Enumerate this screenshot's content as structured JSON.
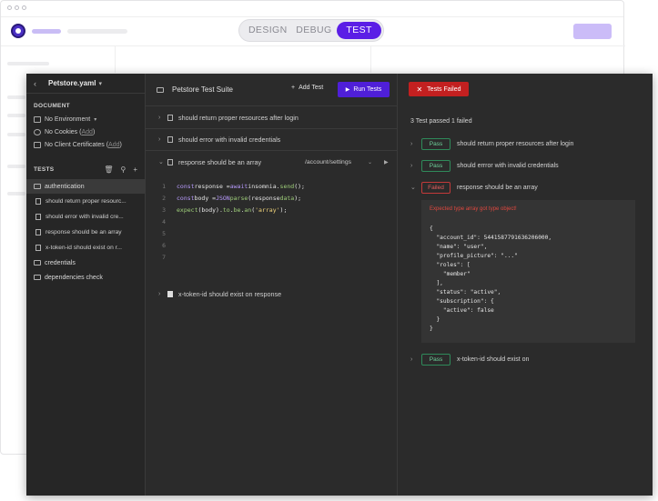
{
  "mode_switch": {
    "design": "DESIGN",
    "debug": "DEBUG",
    "test": "TEST"
  },
  "sidebar": {
    "file_name": "Petstore.yaml",
    "document_label": "DOCUMENT",
    "environment": "No Environment",
    "cookies_text": "No Cookies (",
    "cookies_link": "Add",
    "cookies_end": ")",
    "certs_text": "No Client Certificates (",
    "certs_link": "Add",
    "certs_end": ")",
    "tests_label": "TESTS",
    "groups": [
      {
        "label": "authentication"
      },
      {
        "label": "credentials"
      },
      {
        "label": "dependencies check"
      }
    ],
    "auth_items": [
      "should return proper resourc...",
      "should error with invalid cre...",
      "response should be an array",
      "x-token-id should exist on r..."
    ]
  },
  "suite": {
    "title": "Petstore Test Suite",
    "add_test": "Add Test",
    "run_tests": "Run Tests",
    "tests": [
      "should return proper resources after login",
      "should error with invalid credentials",
      "response should be an array",
      "x-token-id should exist on response"
    ],
    "request_path": "/account/settings",
    "line_numbers": [
      "1",
      "2",
      "3",
      "4",
      "5",
      "6",
      "7"
    ],
    "code": {
      "l1_kw": "const",
      "l1_a": " response = ",
      "l1_kw2": "await",
      "l1_b": " insomnia.",
      "l1_fn": "send",
      "l1_c": "();",
      "l2_kw": "const",
      "l2_a": " body = ",
      "l2_b": "JSON",
      "l2_c": " ",
      "l2_fn": "parse",
      "l2_d": "(response ",
      "l2_fn2": "data",
      "l2_e": ");",
      "l3_fn": "expect",
      "l3_a": "(body).",
      "l3_fn2": "to",
      "l3_b": ".",
      "l3_fn3": "be",
      "l3_c": ".",
      "l3_fn4": "an",
      "l3_d": "(",
      "l3_str": "'array'",
      "l3_e": ");"
    }
  },
  "results": {
    "badge": "Tests Failed",
    "summary": "3 Test passed 1 failed",
    "items": [
      {
        "status": "Pass",
        "label": "should return proper resources after login"
      },
      {
        "status": "Pass",
        "label": "should errror with invalid credentials"
      },
      {
        "status": "Failed",
        "label": "response should be an array"
      },
      {
        "status": "Pass",
        "label": "x-token-id should exist on"
      }
    ],
    "error_message": "Expected type array got type object!",
    "json": "{\n  \"account_id\": 5441587791636206000,\n  \"name\": \"user\",\n  \"profile_picture\": \"...\"\n  \"roles\": [\n    \"member\"\n  ],\n  \"status\": \"active\",\n  \"subscription\": {\n    \"active\": false\n  }\n}"
  },
  "colors": {
    "accent": "#5b1ee6",
    "run_button": "#4f1fd8",
    "fail": "#c32020",
    "pass": "#2f8a5a"
  }
}
